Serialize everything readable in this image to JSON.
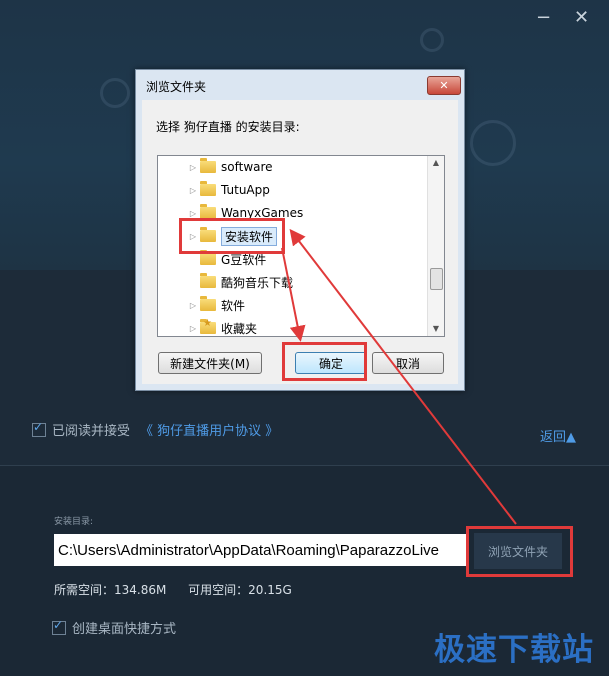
{
  "window": {
    "minimize_glyph": "−",
    "close_glyph": "✕"
  },
  "dialog": {
    "title": "浏览文件夹",
    "close_glyph": "✕",
    "prompt": "选择 狗仔直播 的安装目录:",
    "tree": [
      {
        "label": "software",
        "expander": true,
        "icon": "folder-icon"
      },
      {
        "label": "TutuApp",
        "expander": true,
        "icon": "folder-icon"
      },
      {
        "label": "WanyxGames",
        "expander": true,
        "icon": "folder-icon"
      },
      {
        "label": "安装软件",
        "expander": true,
        "icon": "folder-icon",
        "selected": true
      },
      {
        "label": "G豆软件",
        "expander": false,
        "icon": "folder-icon"
      },
      {
        "label": "酷狗音乐下载",
        "expander": false,
        "icon": "folder-icon"
      },
      {
        "label": "软件",
        "expander": true,
        "icon": "folder-icon"
      },
      {
        "label": "收藏夹",
        "expander": true,
        "icon": "favorites-folder-icon"
      }
    ],
    "buttons": {
      "new_folder": "新建文件夹(M)",
      "ok": "确定",
      "cancel": "取消"
    }
  },
  "installer": {
    "agree_text": "已阅读并接受",
    "agree_link": "《 狗仔直播用户协议 》",
    "back_link": "返回▲",
    "dir_label": "安装目录:",
    "dir_value": "C:\\Users\\Administrator\\AppData\\Roaming\\PaparazzoLive",
    "browse_button": "浏览文件夹",
    "required_space": "所需空间：134.86M",
    "available_space": "可用空间：20.15G",
    "create_shortcut": "创建桌面快捷方式"
  },
  "watermark": "极速下载站",
  "colors": {
    "highlight": "#e03a3a",
    "link": "#4f9be6",
    "watermark": "#2b6fc4"
  }
}
